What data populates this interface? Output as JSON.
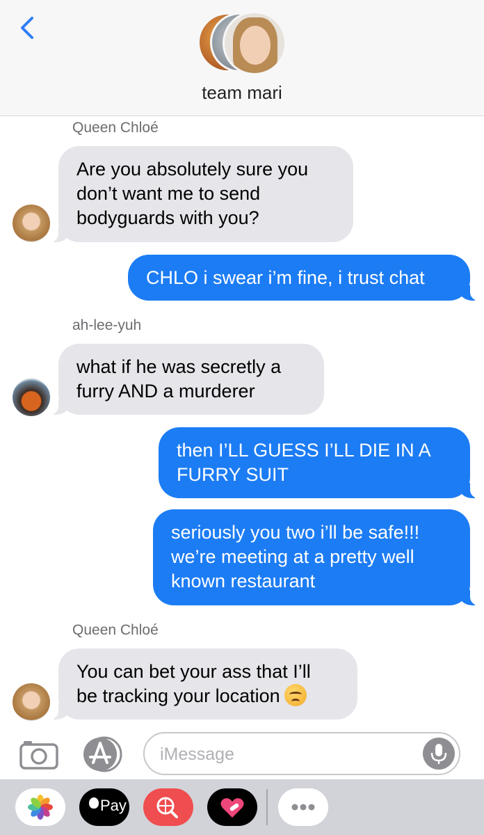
{
  "header": {
    "back_label": "Back",
    "title": "team mari"
  },
  "messages": [
    {
      "sender": "Queen Chloé",
      "text": "Are you absolutely sure you\ndon’t want me to send\nbodyguards with you?"
    },
    {
      "text": "CHLO i swear i’m fine, i trust chat"
    },
    {
      "sender": "ah-lee-yuh",
      "text": "what if he was secretly a\nfurry AND a murderer"
    },
    {
      "text": "then I’LL GUESS I’LL DIE IN A\nFURRY SUIT"
    },
    {
      "text": "seriously you two i’ll be safe!!!\nwe’re meeting at a pretty well\nknown restaurant"
    },
    {
      "sender": "Queen Chloé",
      "text": "You can bet your ass that I’ll\nbe tracking your location",
      "emoji": "angry-face"
    }
  ],
  "composer": {
    "placeholder": "iMessage",
    "camera_icon": "camera-icon",
    "appstore_icon": "app-store-icon",
    "mic_icon": "microphone-icon"
  },
  "app_tray": {
    "items": [
      {
        "icon": "photos-icon"
      },
      {
        "icon": "apple-pay-icon",
        "label": "Pay"
      },
      {
        "icon": "web-search-icon"
      },
      {
        "icon": "digital-touch-icon"
      },
      {
        "icon": "more-icon"
      }
    ]
  },
  "colors": {
    "outgoing_bubble": "#1c7cf4",
    "incoming_bubble": "#e5e5ea",
    "accent": "#2f7ef6"
  }
}
